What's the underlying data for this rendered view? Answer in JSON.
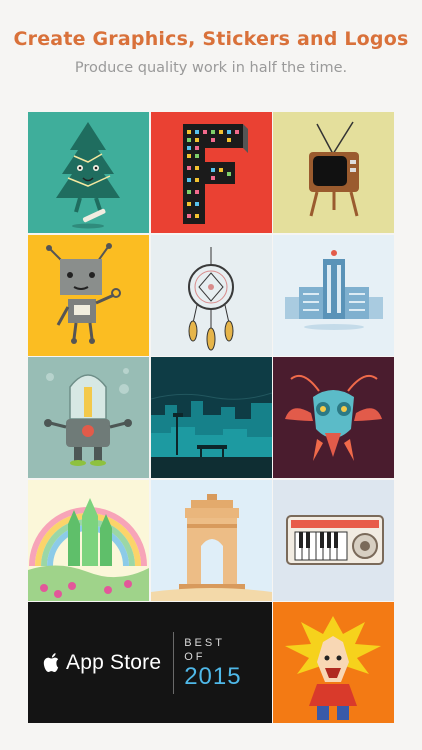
{
  "header": {
    "title": "Create Graphics, Stickers and Logos",
    "subtitle": "Produce quality work in half the time."
  },
  "tiles": [
    {
      "subject": "christmas-tree",
      "bg": "#3fae9b"
    },
    {
      "subject": "letter-f",
      "bg": "#ea4133"
    },
    {
      "subject": "retro-tv",
      "bg": "#e4df9c"
    },
    {
      "subject": "robot",
      "bg": "#fbbd22"
    },
    {
      "subject": "dreamcatcher",
      "bg": "#e7eef1"
    },
    {
      "subject": "building",
      "bg": "#e6f0f6"
    },
    {
      "subject": "robot-capsule",
      "bg": "#98bdb5"
    },
    {
      "subject": "night-city",
      "bg": "#0e3c45"
    },
    {
      "subject": "insect-mask",
      "bg": "#4a1c2e"
    },
    {
      "subject": "emerald-city",
      "bg": "#fbf7d9"
    },
    {
      "subject": "india-gate",
      "bg": "#dfeef8"
    },
    {
      "subject": "keyboard",
      "bg": "#dde6ef"
    },
    {
      "subject": "cartoon-hero",
      "bg": "#f37a14"
    }
  ],
  "badge": {
    "store_label": "App Store",
    "best_label": "BEST",
    "of_label": "OF",
    "year": "2015"
  }
}
